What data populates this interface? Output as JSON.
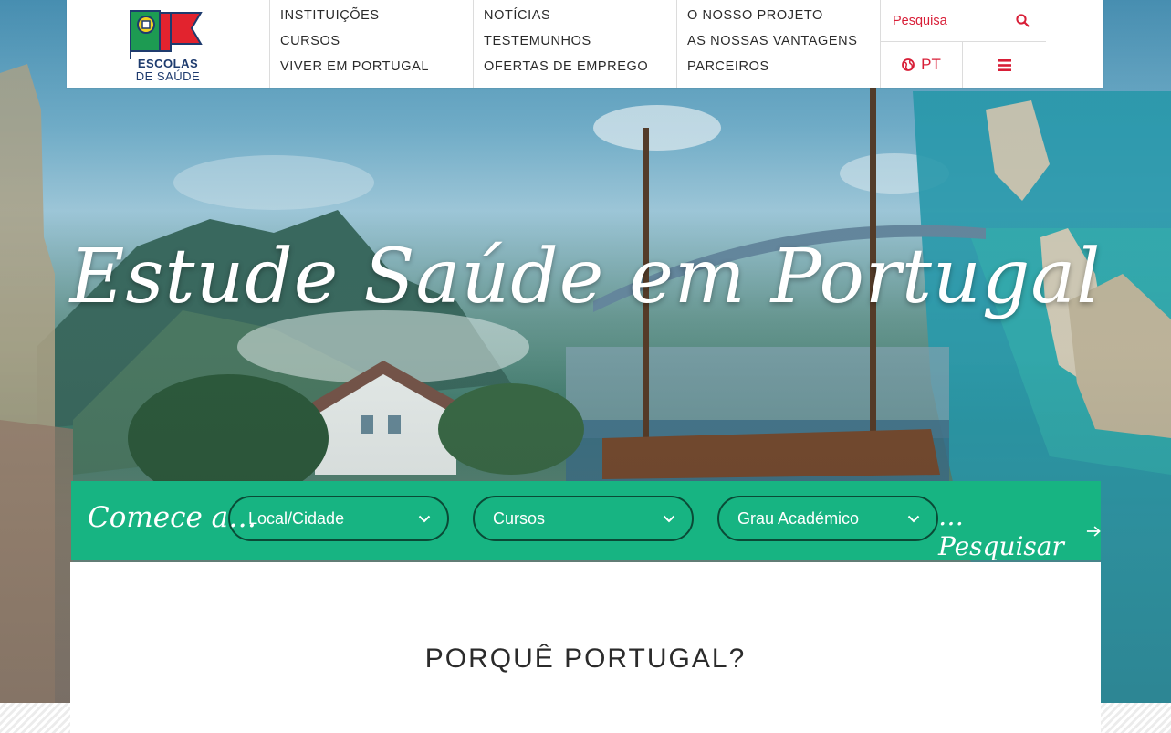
{
  "logo": {
    "line1": "ESCOLAS",
    "line2": "DE SAÚDE"
  },
  "nav": {
    "col1": [
      "INSTITUIÇÕES",
      "CURSOS",
      "VIVER EM PORTUGAL"
    ],
    "col2": [
      "NOTÍCIAS",
      "TESTEMUNHOS",
      "OFERTAS DE EMPREGO"
    ],
    "col3": [
      "O NOSSO PROJETO",
      "AS NOSSAS VANTAGENS",
      "PARCEIROS"
    ]
  },
  "tools": {
    "search_label": "Pesquisa",
    "search_icon": "search-icon",
    "language": "PT",
    "language_icon": "globe-icon",
    "menu_icon": "hamburger-menu-icon"
  },
  "hero": {
    "title": "Estude Saúde em Portugal"
  },
  "search_bar": {
    "intro": "Comece a…",
    "filters": [
      "Local/Cidade",
      "Cursos",
      "Grau Académico"
    ],
    "submit": "…Pesquisar"
  },
  "section": {
    "title": "PORQUÊ PORTUGAL?"
  },
  "colors": {
    "accent_red": "#d81e37",
    "search_bar_green": "#17b482",
    "dropdown_border": "#0a4a36",
    "logo_blue": "#1e3b6e",
    "logo_green": "#1d9b52"
  }
}
